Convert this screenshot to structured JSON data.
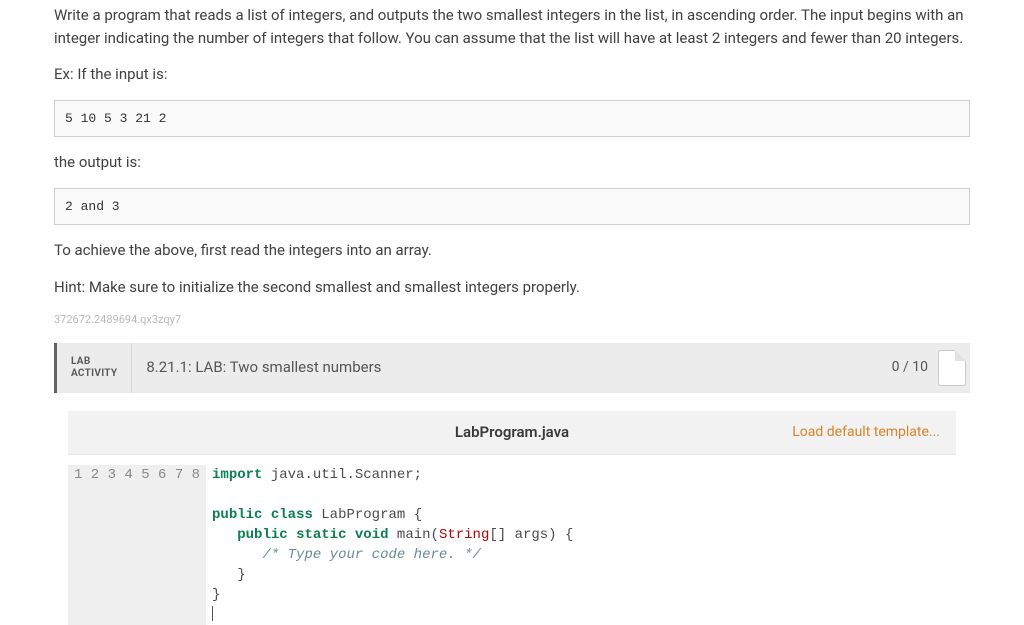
{
  "problem": {
    "p1": "Write a program that reads a list of integers, and outputs the two smallest integers in the list, in ascending order. The input begins with an integer indicating the number of integers that follow. You can assume that the list will have at least 2 integers and fewer than 20 integers.",
    "ex_label": "Ex: If the input is:",
    "input_example": "5 10 5 3 21 2",
    "output_label": "the output is:",
    "output_example": "2 and 3",
    "p2": "To achieve the above, first read the integers into an array.",
    "hint": "Hint: Make sure to initialize the second smallest and smallest integers properly.",
    "tiny_id": "372672.2489694.qx3zqy7"
  },
  "activity": {
    "label_line1": "LAB",
    "label_line2": "ACTIVITY",
    "title": "8.21.1: LAB: Two smallest numbers",
    "score": "0 / 10"
  },
  "editor": {
    "filename": "LabProgram.java",
    "load_link": "Load default template...",
    "lines": [
      {
        "n": 1,
        "kw1": "import",
        "rest": " java.util.Scanner;"
      },
      {
        "n": 2,
        "rest": ""
      },
      {
        "n": 3,
        "kw1": "public",
        "kw2": "class",
        "rest": " LabProgram {"
      },
      {
        "n": 4,
        "indent": "   ",
        "kw1": "public",
        "kw2": "static",
        "kw3": "void",
        "name": " main(",
        "type": "String",
        "rest": "[] args) {"
      },
      {
        "n": 5,
        "indent": "      ",
        "comment": "/* Type your code here. */"
      },
      {
        "n": 6,
        "indent": "   ",
        "rest": "}"
      },
      {
        "n": 7,
        "rest": "}"
      },
      {
        "n": 8,
        "rest": ""
      }
    ]
  }
}
